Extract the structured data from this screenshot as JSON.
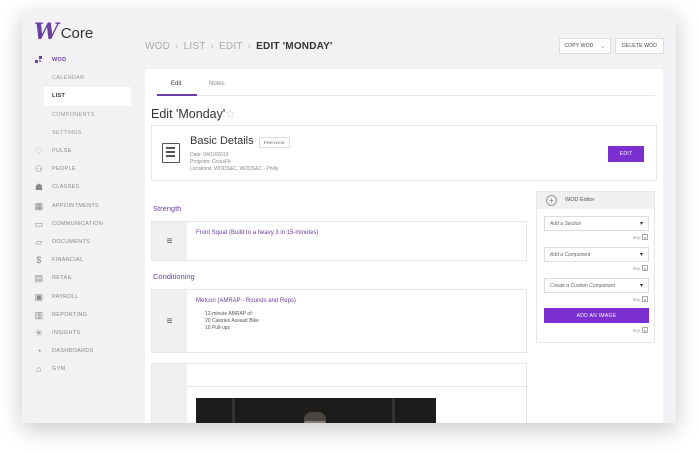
{
  "app": {
    "logo_mark": "W",
    "logo_text": "Core"
  },
  "sidebar": {
    "items": [
      {
        "label": "WOD",
        "icon": "puzzle-icon",
        "active": true
      },
      {
        "label": "PULSE",
        "icon": "pulse-icon"
      },
      {
        "label": "PEOPLE",
        "icon": "people-icon"
      },
      {
        "label": "CLASSES",
        "icon": "classes-icon"
      },
      {
        "label": "APPOINTMENTS",
        "icon": "calendar-icon"
      },
      {
        "label": "COMMUNICATION",
        "icon": "chat-icon"
      },
      {
        "label": "DOCUMENTS",
        "icon": "folder-icon"
      },
      {
        "label": "FINANCIAL",
        "icon": "dollar-icon"
      },
      {
        "label": "RETAIL",
        "icon": "retail-icon"
      },
      {
        "label": "PAYROLL",
        "icon": "payroll-icon"
      },
      {
        "label": "REPORTING",
        "icon": "report-icon"
      },
      {
        "label": "INSIGHTS",
        "icon": "insights-icon"
      },
      {
        "label": "DASHBOARDS",
        "icon": "dashboard-icon"
      },
      {
        "label": "GYM",
        "icon": "gym-icon"
      }
    ],
    "wod_sub": [
      "CALENDAR",
      "LIST",
      "COMPONENTS",
      "SETTINGS"
    ],
    "selected_sub": "LIST"
  },
  "header": {
    "breadcrumb": [
      "WOD",
      "LIST",
      "EDIT"
    ],
    "current": "EDIT 'MONDAY'",
    "copy_wod": "COPY WOD",
    "delete_wod": "DELETE WOD"
  },
  "tabs": [
    "Edit",
    "Notes"
  ],
  "page_title": "Edit 'Monday'",
  "basic_details": {
    "title": "Basic Details",
    "preview": "PREVIEW",
    "date": "Date: 04/10/2019",
    "program": "Program: CrossFit",
    "locations": "Locations: WODS&C, WODS&C - Philly",
    "edit": "EDIT"
  },
  "sections": [
    {
      "title": "Strength",
      "components": [
        {
          "title": "Front Squat (Build to a heavy 3 in 15-minutes)",
          "lines": []
        }
      ]
    },
    {
      "title": "Conditioning",
      "components": [
        {
          "title": "Metcon (AMRAP - Rounds and Reps)",
          "lines": [
            "12-minute AMRAP of:",
            "20 Calories Assault Bike",
            "10 Pull-ups"
          ]
        }
      ]
    }
  ],
  "editor": {
    "title": "WOD Editor",
    "add_section": "Add a Section",
    "add_component": "Add a Component",
    "custom_component": "Create a Custom Component",
    "key_label": "key",
    "key_badge": "s",
    "add_image": "ADD AN IMAGE"
  },
  "colors": {
    "accent": "#6b3fa0",
    "button": "#7b2fd0"
  }
}
